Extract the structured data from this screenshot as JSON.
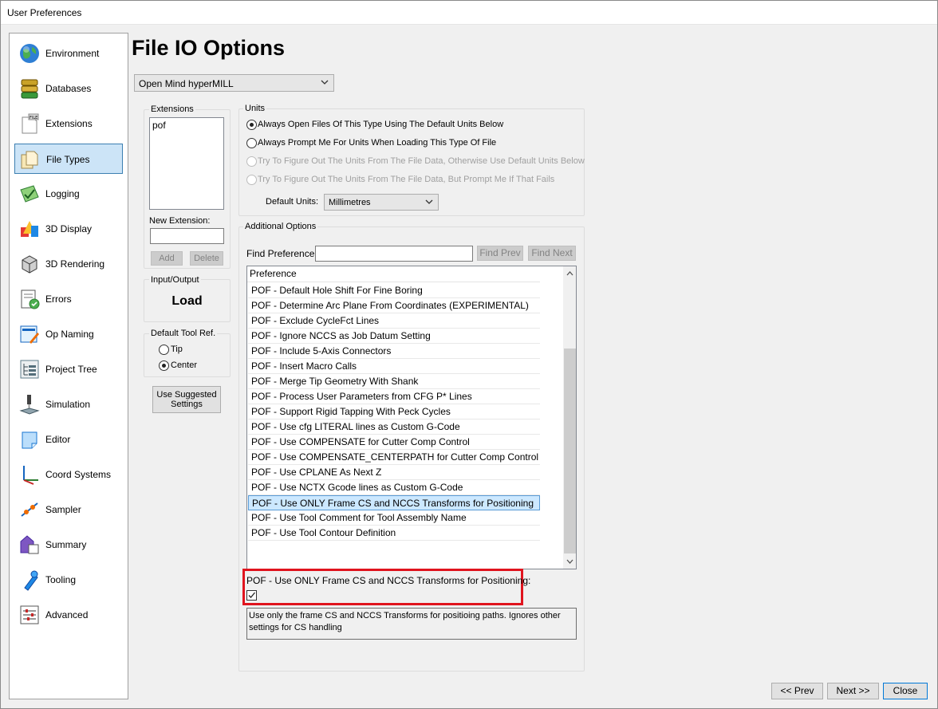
{
  "window": {
    "title": "User Preferences"
  },
  "sidebar": {
    "items": [
      {
        "label": "Environment",
        "icon": "globe-icon"
      },
      {
        "label": "Databases",
        "icon": "database-icon"
      },
      {
        "label": "Extensions",
        "icon": "file-extension-icon"
      },
      {
        "label": "File Types",
        "icon": "file-types-icon",
        "selected": true
      },
      {
        "label": "Logging",
        "icon": "logging-icon"
      },
      {
        "label": "3D Display",
        "icon": "3d-display-icon"
      },
      {
        "label": "3D Rendering",
        "icon": "3d-rendering-icon"
      },
      {
        "label": "Errors",
        "icon": "errors-icon"
      },
      {
        "label": "Op Naming",
        "icon": "op-naming-icon"
      },
      {
        "label": "Project Tree",
        "icon": "project-tree-icon"
      },
      {
        "label": "Simulation",
        "icon": "simulation-icon"
      },
      {
        "label": "Editor",
        "icon": "editor-icon"
      },
      {
        "label": "Coord Systems",
        "icon": "coord-systems-icon"
      },
      {
        "label": "Sampler",
        "icon": "sampler-icon"
      },
      {
        "label": "Summary",
        "icon": "summary-icon"
      },
      {
        "label": "Tooling",
        "icon": "tooling-icon"
      },
      {
        "label": "Advanced",
        "icon": "advanced-icon"
      }
    ]
  },
  "page": {
    "title": "File IO Options",
    "file_type_select": "Open Mind hyperMILL"
  },
  "extensions": {
    "group_label": "Extensions",
    "items": [
      "pof"
    ],
    "new_extension_label": "New Extension:",
    "new_extension_value": "",
    "add_label": "Add",
    "delete_label": "Delete"
  },
  "io": {
    "group_label": "Input/Output",
    "value": "Load"
  },
  "tool_ref": {
    "group_label": "Default Tool Ref.",
    "options": [
      "Tip",
      "Center"
    ],
    "selected": "Center"
  },
  "use_suggested": {
    "line1": "Use Suggested",
    "line2": "Settings"
  },
  "units": {
    "group_label": "Units",
    "options": [
      {
        "label": "Always Open Files Of This Type Using The Default Units Below",
        "checked": true,
        "enabled": true
      },
      {
        "label": "Always Prompt Me For Units When Loading This Type Of File",
        "checked": false,
        "enabled": true
      },
      {
        "label": "Try To Figure Out The Units From The File Data, Otherwise Use Default Units Below",
        "checked": false,
        "enabled": false
      },
      {
        "label": "Try To Figure Out The Units From The File Data, But Prompt Me If That Fails",
        "checked": false,
        "enabled": false
      }
    ],
    "default_units_label": "Default Units:",
    "default_units_value": "Millimetres"
  },
  "additional": {
    "group_label": "Additional Options",
    "find_label": "Find Preference",
    "find_value": "",
    "find_prev": "Find Prev",
    "find_next": "Find Next",
    "list_header": "Preference",
    "rows": [
      "POF - Default Hole Shift For Fine Boring",
      "POF - Determine Arc Plane From Coordinates (EXPERIMENTAL)",
      "POF - Exclude CycleFct Lines",
      "POF - Ignore NCCS as Job Datum Setting",
      "POF - Include 5-Axis Connectors",
      "POF - Insert Macro Calls",
      "POF - Merge Tip Geometry With Shank",
      "POF - Process User Parameters from CFG P* Lines",
      "POF - Support Rigid Tapping With Peck Cycles",
      "POF - Use cfg LITERAL lines as Custom G-Code",
      "POF - Use COMPENSATE for Cutter Comp Control",
      "POF - Use COMPENSATE_CENTERPATH for Cutter Comp Control",
      "POF - Use CPLANE As Next Z",
      "POF - Use NCTX Gcode lines as Custom G-Code",
      "POF - Use ONLY Frame CS and NCCS Transforms for Positioning",
      "POF - Use Tool Comment for Tool Assembly Name",
      "POF - Use Tool Contour Definition"
    ],
    "selected_index": 14,
    "detail_label": "POF - Use ONLY Frame CS and NCCS Transforms for Positioning:",
    "detail_checked": true,
    "description": "Use only the frame CS and NCCS Transforms for positioing paths.  Ignores other settings for CS handling",
    "highlight_color": "#e0141e"
  },
  "footer": {
    "prev_label": "<< Prev",
    "next_label": "Next >>",
    "close_label": "Close"
  }
}
